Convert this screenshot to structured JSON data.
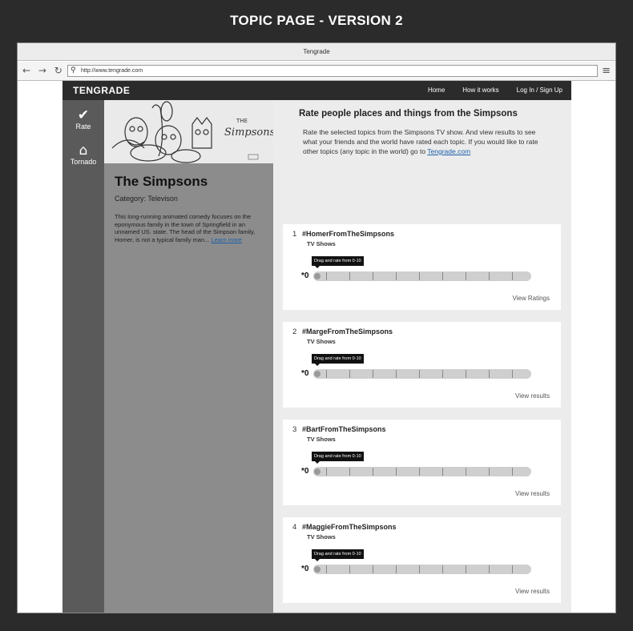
{
  "page": {
    "heading": "TOPIC PAGE - VERSION 2"
  },
  "browser": {
    "title": "Tengrade",
    "url": "http://www.tengrade.com",
    "nav_icons": "← → ↻",
    "menu_icon": "≡"
  },
  "app": {
    "logo": "TENGRADE",
    "nav": [
      "Home",
      "How it works",
      "Log In / Sign Up"
    ],
    "rail": [
      {
        "icon": "checkmark-icon",
        "glyph": "✔",
        "label": "Rate"
      },
      {
        "icon": "house-icon",
        "glyph": "⌂",
        "label": "Tornado"
      }
    ]
  },
  "topic": {
    "title": "The Simpsons",
    "category": "Category: Televison",
    "description": "This long-running animated comedy focuses on the eponymous family in the town of Springfield in an unnamed US. state. The head of the Simpson family, Homer, is not a typical family man... ",
    "learn_more": "Learn more"
  },
  "intro": {
    "title": "Rate people places and things from the Simpsons",
    "text": "Rate the selected topics from the Simpsons TV show. And view results to see what your friends and the world have rated each topic. If you would like to rate other topics (any topic in the world) go to ",
    "link": "Tengrade.com"
  },
  "cards": [
    {
      "num": "1",
      "tag": "#HomerFromTheSimpsons",
      "category": "TV Shows",
      "tooltip": "Drag and rate from 0-10",
      "score": "*0",
      "link": "View Ratings"
    },
    {
      "num": "2",
      "tag": "#MargeFromTheSimpsons",
      "category": "TV Shows",
      "tooltip": "Drag and rate from 0-10",
      "score": "*0",
      "link": "View results"
    },
    {
      "num": "3",
      "tag": "#BartFromTheSimpsons",
      "category": "TV Shows",
      "tooltip": "Drag and rate from 0-10",
      "score": "*0",
      "link": "View results"
    },
    {
      "num": "4",
      "tag": "#MaggieFromTheSimpsons",
      "category": "TV Shows",
      "tooltip": "Drag and rate from 0-10",
      "score": "*0",
      "link": "View results"
    }
  ],
  "image_logo_text": "THE Simpsons"
}
